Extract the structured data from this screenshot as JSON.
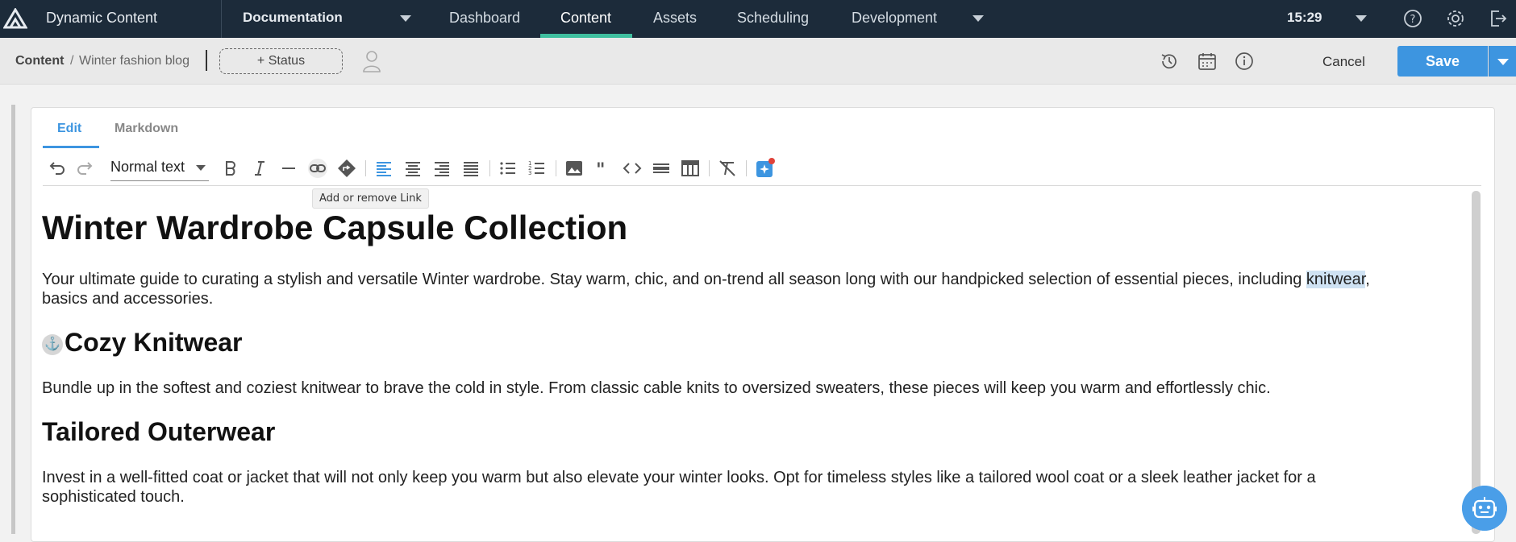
{
  "topbar": {
    "app_name": "Dynamic Content",
    "hub_selector": "Documentation",
    "nav": [
      "Dashboard",
      "Content",
      "Assets",
      "Scheduling",
      "Development"
    ],
    "active_nav": "Content",
    "clock": "15:29",
    "icons": [
      "help-icon",
      "settings-icon",
      "logout-icon"
    ]
  },
  "actionbar": {
    "breadcrumb_root": "Content",
    "breadcrumb_sep": "/",
    "breadcrumb_page": "Winter fashion blog",
    "status_button": "+ Status",
    "icons": [
      "history-icon",
      "calendar-icon",
      "info-icon"
    ],
    "cancel_label": "Cancel",
    "save_label": "Save"
  },
  "editor": {
    "tabs": [
      "Edit",
      "Markdown"
    ],
    "active_tab": "Edit",
    "format_select": "Normal text",
    "tooltip": "Add or remove Link",
    "toolbar_icons": [
      "undo-icon",
      "redo-icon",
      "bold-icon",
      "italic-icon",
      "horizontal-rule-icon",
      "link-icon",
      "anchor-icon",
      "align-left-icon",
      "align-center-icon",
      "align-right-icon",
      "align-justify-icon",
      "bullet-list-icon",
      "numbered-list-icon",
      "image-icon",
      "quote-icon",
      "code-icon",
      "divider-icon",
      "table-icon",
      "clear-format-icon",
      "ai-assistant-icon"
    ]
  },
  "document": {
    "title": "Winter Wardrobe Capsule Collection",
    "intro_before": "Your ultimate guide to curating a stylish and versatile Winter wardrobe. Stay warm, chic, and on-trend all season long with our handpicked selection of essential pieces, including ",
    "intro_highlight": "knitwear",
    "intro_after": ",",
    "intro_line2": "basics and accessories.",
    "section1_title": "Cozy Knitwear",
    "section1_anchor": "⚓",
    "section1_body": "Bundle up in the softest and coziest knitwear to brave the cold in style. From classic cable knits to oversized sweaters, these pieces will keep you warm and effortlessly chic.",
    "section2_title": "Tailored Outerwear",
    "section2_body_line1": "Invest in a well-fitted coat or jacket that will not only keep you warm but also elevate your winter looks. Opt for timeless styles like a tailored wool coat or a sleek leather jacket for a",
    "section2_body_line2": "sophisticated touch."
  },
  "colors": {
    "topbar_bg": "#1c2b3a",
    "accent_green": "#3fbf9f",
    "primary_blue": "#3d95e0",
    "highlight": "#cfe2f3"
  }
}
